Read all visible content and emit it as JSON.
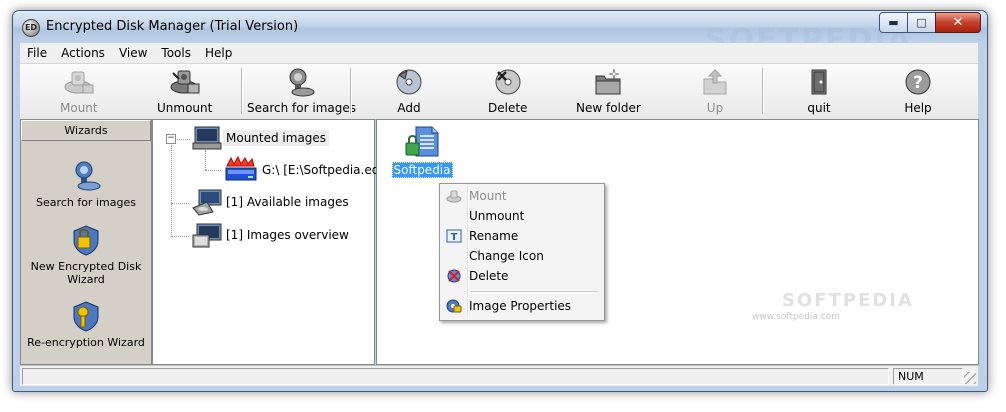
{
  "window": {
    "title": "Encrypted Disk Manager (Trial Version)",
    "icon_text": "ED"
  },
  "menu": [
    "File",
    "Actions",
    "View",
    "Tools",
    "Help"
  ],
  "toolbar": {
    "mount": "Mount",
    "unmount": "Unmount",
    "search": "Search for images",
    "add": "Add",
    "delete": "Delete",
    "new_folder": "New folder",
    "up": "Up",
    "quit": "quit",
    "help": "Help"
  },
  "wizards": {
    "header": "Wizards",
    "items": [
      "Search for images",
      "New Encrypted Disk Wizard",
      "Re-encryption Wizard"
    ]
  },
  "tree": {
    "mounted": "Mounted images",
    "drive": "G:\\ [E:\\Softpedia.ed]",
    "available": "[1] Available images",
    "overview": "[1] Images overview"
  },
  "files": [
    {
      "name": "Softpedia"
    }
  ],
  "context_menu": {
    "mount": "Mount",
    "unmount": "Unmount",
    "rename": "Rename",
    "change_icon": "Change Icon",
    "delete": "Delete",
    "properties": "Image Properties"
  },
  "status": {
    "num": "NUM"
  },
  "watermarks": {
    "top": "SOFTPEDIA",
    "mid": "SOFTPEDIA",
    "url": "www.softpedia.com"
  },
  "colors": {
    "selection": "#3399ff",
    "titlebar": "#c4d6eb",
    "panel": "#d4d0c8"
  }
}
